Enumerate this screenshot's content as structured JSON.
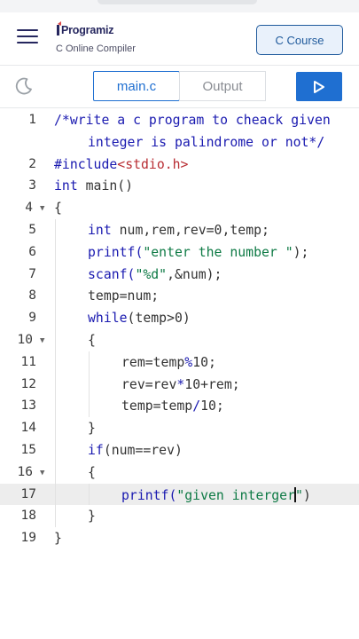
{
  "header": {
    "logo_text": "Programiz",
    "subtitle": "C Online Compiler",
    "course_button": "C Course"
  },
  "toolbar": {
    "tab_main": "main.c",
    "tab_output": "Output"
  },
  "colors": {
    "brand_navy": "#25265e",
    "accent_blue": "#1f6fd1",
    "keyword": "#1a1ab0",
    "string": "#0e7a45",
    "header_file": "#b82d33"
  },
  "editor": {
    "line_numbers": [
      "1",
      "2",
      "3",
      "4",
      "5",
      "6",
      "7",
      "8",
      "9",
      "10",
      "11",
      "12",
      "13",
      "14",
      "15",
      "16",
      "17",
      "18",
      "19"
    ],
    "active_line": 17,
    "code": {
      "l1a": "/*write a c program to cheack given",
      "l1b": "integer is palindrome or not*/",
      "l2_inc": "#include",
      "l2_hdr": "<stdio.h>",
      "l3_kw": "int",
      "l3_rest": " main()",
      "l4": "{",
      "l5_kw": "int",
      "l5_a": " num,rem,rev=",
      "l5_n": "0",
      "l5_b": ",temp;",
      "l6_fn": "printf(",
      "l6_str": "\"enter the number \"",
      "l6_end": ");",
      "l7_fn": "scanf(",
      "l7_str": "\"%d\"",
      "l7_end": ",&num);",
      "l8": "temp=num;",
      "l9_kw": "while",
      "l9_rest": "(temp>0)",
      "l10": "{",
      "l11_a": "rem=temp",
      "l11_op": "%",
      "l11_b": "10;",
      "l12_a": "rev=rev",
      "l12_op": "*",
      "l12_b": "10+rem;",
      "l13_a": "temp=temp",
      "l13_op": "/",
      "l13_b": "10;",
      "l14": "}",
      "l15_kw": "if",
      "l15_rest": "(num==rev)",
      "l16": "{",
      "l17_fn": "printf(",
      "l17_str": "\"given interger",
      "l17_q": "\"",
      "l17_end": ")",
      "l18": "}",
      "l19": "}"
    }
  },
  "icons": {
    "menu": "hamburger-icon",
    "theme": "moon-icon",
    "run": "play-icon",
    "fold": "chevron-down-icon"
  }
}
